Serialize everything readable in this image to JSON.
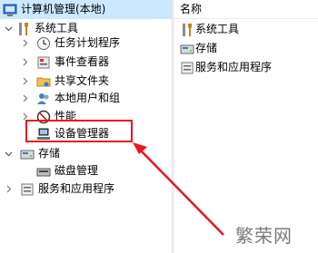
{
  "tree": {
    "root": "计算机管理(本地)",
    "system_tools": "系统工具",
    "task_scheduler": "任务计划程序",
    "event_viewer": "事件查看器",
    "shared_folders": "共享文件夹",
    "local_users": "本地用户和组",
    "performance": "性能",
    "device_manager": "设备管理器",
    "storage": "存储",
    "disk_management": "磁盘管理",
    "services_apps": "服务和应用程序"
  },
  "list": {
    "header": "名称",
    "items": [
      "系统工具",
      "存储",
      "服务和应用程序"
    ]
  },
  "watermark": "繁荣网",
  "colors": {
    "selection": "#cce8ff",
    "highlight_box": "#e8171e",
    "arrow": "#e8171e"
  }
}
